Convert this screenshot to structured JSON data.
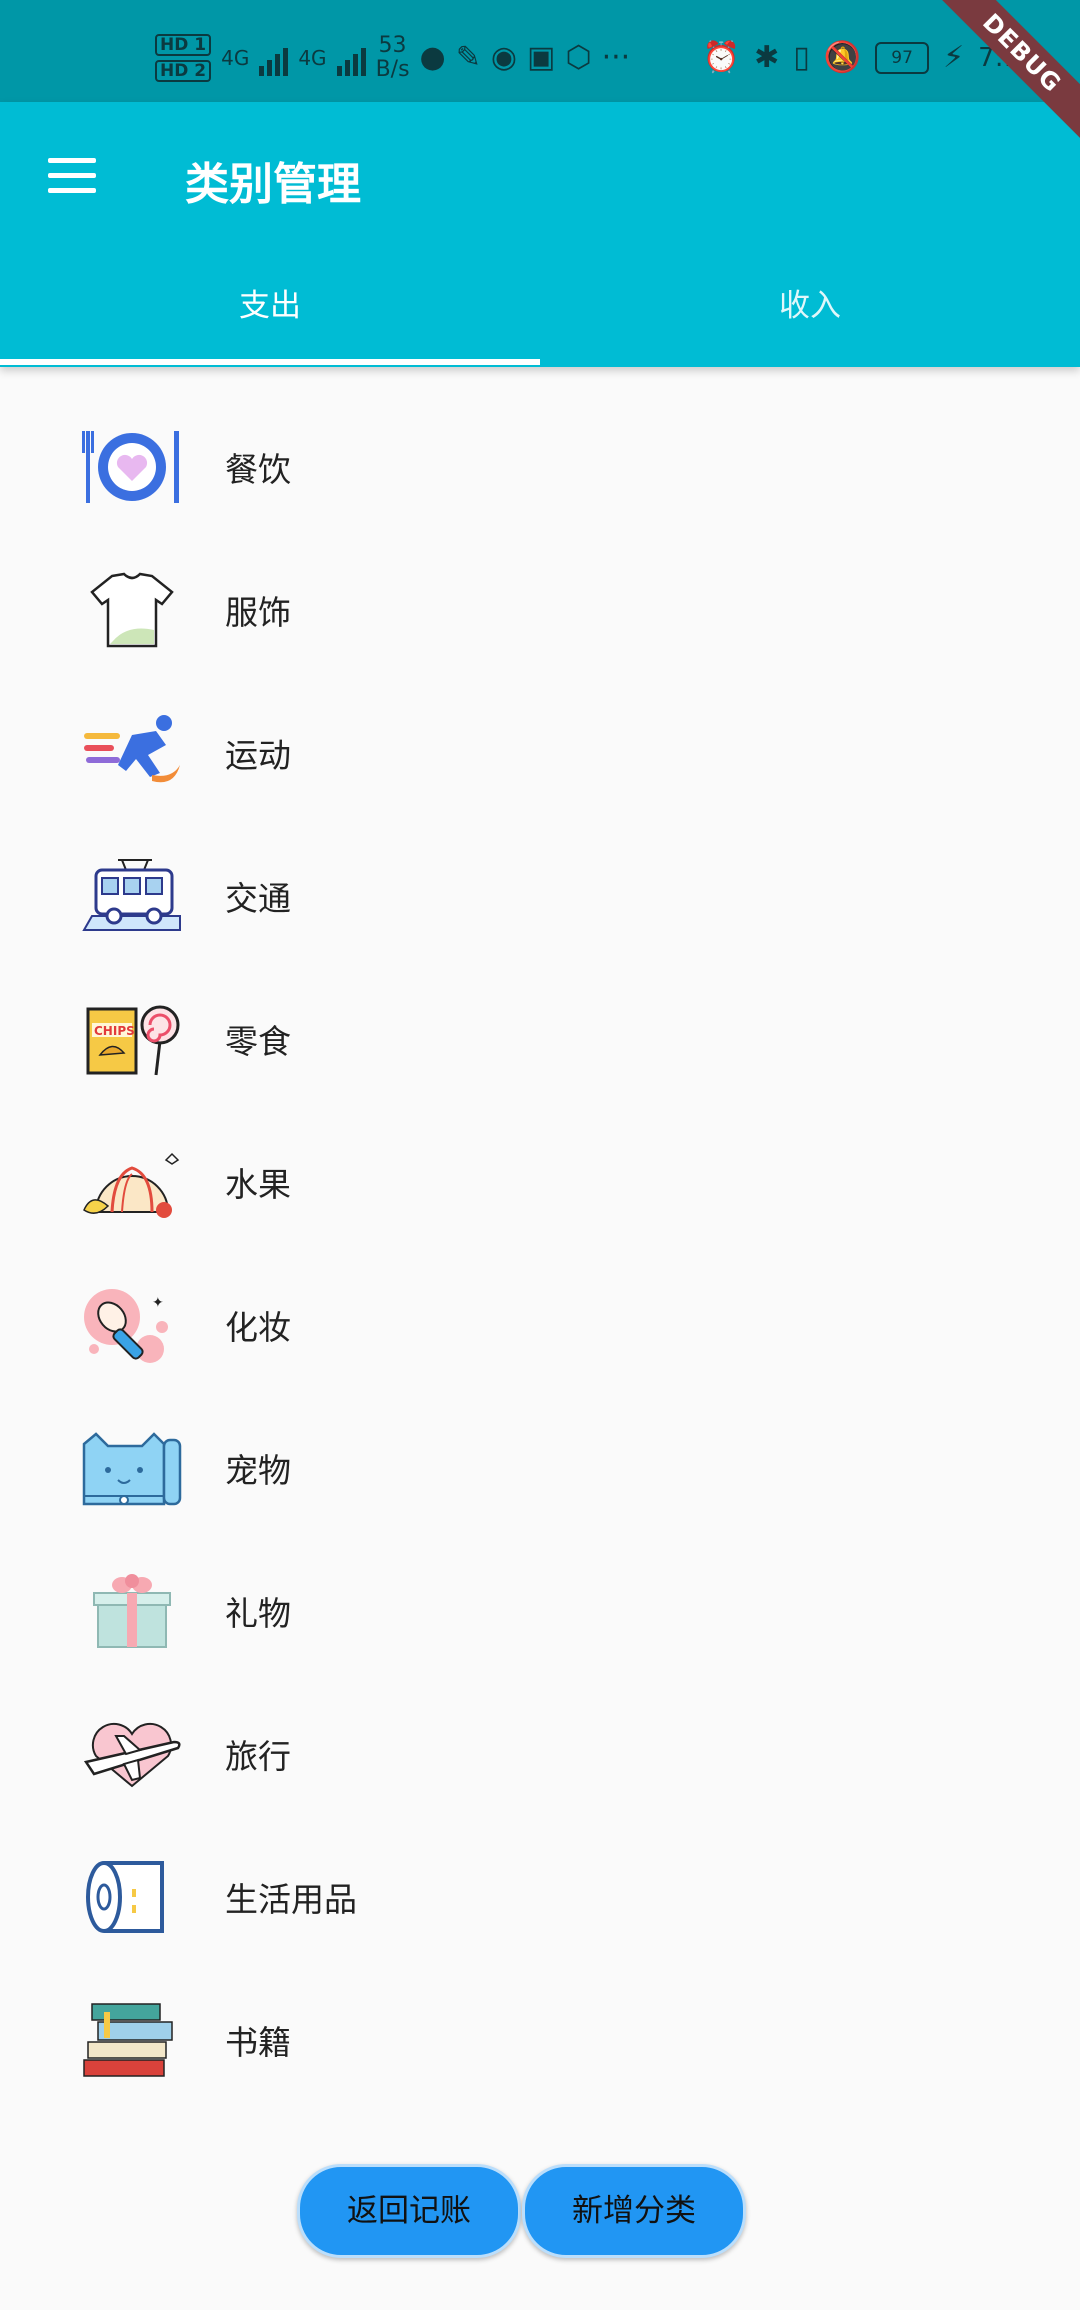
{
  "status_bar": {
    "hd1": "HD 1",
    "hd2": "HD 2",
    "sig1": "4G",
    "sig2": "4G",
    "net_speed": "53",
    "net_unit": "B/s",
    "battery": "97",
    "time": "7:1"
  },
  "debug_banner": "DEBUG",
  "app_bar": {
    "title": "类别管理",
    "tabs": [
      {
        "label": "支出",
        "active": true
      },
      {
        "label": "收入",
        "active": false
      }
    ]
  },
  "categories": [
    {
      "label": "餐饮",
      "icon": "dining-icon"
    },
    {
      "label": "服饰",
      "icon": "tshirt-icon"
    },
    {
      "label": "运动",
      "icon": "running-icon"
    },
    {
      "label": "交通",
      "icon": "bus-icon"
    },
    {
      "label": "零食",
      "icon": "chips-lollipop-icon"
    },
    {
      "label": "水果",
      "icon": "fruit-icon"
    },
    {
      "label": "化妆",
      "icon": "makeup-brush-icon"
    },
    {
      "label": "宠物",
      "icon": "cat-icon"
    },
    {
      "label": "礼物",
      "icon": "gift-icon"
    },
    {
      "label": "旅行",
      "icon": "airplane-icon"
    },
    {
      "label": "生活用品",
      "icon": "toilet-paper-icon"
    },
    {
      "label": "书籍",
      "icon": "books-icon"
    }
  ],
  "buttons": {
    "back": "返回记账",
    "add": "新增分类"
  },
  "colors": {
    "status_bar": "#0097a7",
    "app_bar": "#00bcd4",
    "button": "#2196f3",
    "background": "#fafafa"
  }
}
